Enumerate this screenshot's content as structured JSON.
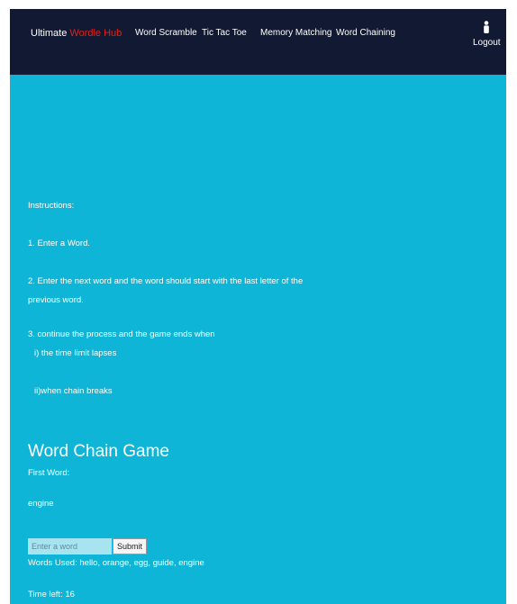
{
  "navbar": {
    "brand_prefix": "Ultimate",
    "brand_highlight": "Wordle Hub",
    "links": [
      {
        "label": "Word Scramble"
      },
      {
        "label": "Tic Tac Toe"
      },
      {
        "label": "Memory Matching"
      },
      {
        "label": "Word Chaining"
      }
    ],
    "user_icon": "person-icon",
    "logout_label": "Logout"
  },
  "instructions": {
    "title": "Instructions:",
    "step1": "1. Enter a Word.",
    "step2_line1": "2. Enter the next word and the word should start with the last letter of the",
    "step2_line2": "previous word.",
    "step3_line1": "3. continue the process and the game ends when",
    "step3_line2": "i) the time limit lapses",
    "step3_line3": "ii)when chain breaks"
  },
  "game": {
    "title": "Word Chain Game",
    "first_word_label": "First Word:",
    "first_word": "engine",
    "input_placeholder": "Enter a word",
    "submit_label": "Submit",
    "words_used": "Words Used: hello, orange, egg, guide, engine",
    "time_left": "Time left: 16"
  },
  "colors": {
    "navbar_bg": "#121a33",
    "page_bg": "#0fb5d6",
    "brand_accent": "#e0221e"
  }
}
